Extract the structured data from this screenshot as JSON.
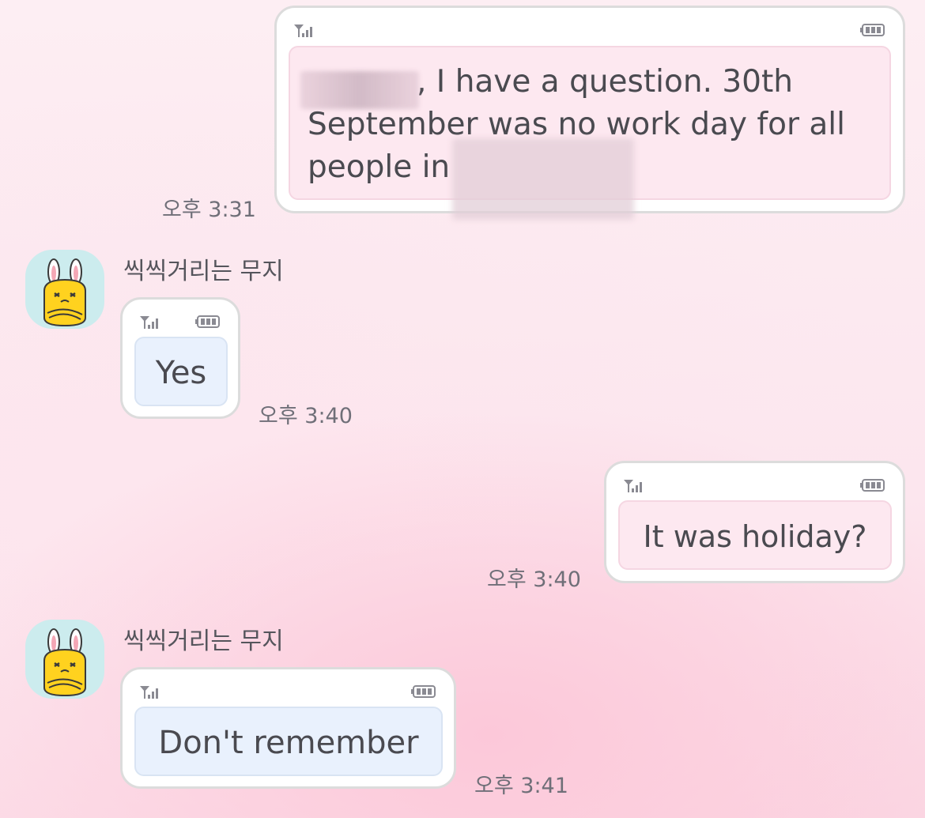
{
  "conversation": {
    "contact_name": "씩씩거리는 무지",
    "messages": [
      {
        "direction": "sent",
        "text_lines": [
          ", I have a question. 30th",
          "September was no work day for all",
          "people in"
        ],
        "time": "오후 3:31"
      },
      {
        "direction": "received",
        "sender": "씩씩거리는 무지",
        "text": "Yes",
        "time": "오후 3:40"
      },
      {
        "direction": "sent",
        "text": "It was holiday?",
        "time": "오후 3:40"
      },
      {
        "direction": "received",
        "sender": "씩씩거리는 무지",
        "text": "Don't remember",
        "time": "오후 3:41"
      }
    ]
  },
  "icons": {
    "signal": "signal-bars-icon",
    "battery": "battery-icon",
    "avatar": "rabbit-character-avatar"
  },
  "colors": {
    "sent_screen": "#fde8f0",
    "received_screen": "#e9f1fd",
    "frame": "#ffffff",
    "frame_border": "#dcdcdc",
    "avatar_bg": "#ccecee",
    "text": "#4a4a50",
    "time_text": "#6f6f78"
  }
}
